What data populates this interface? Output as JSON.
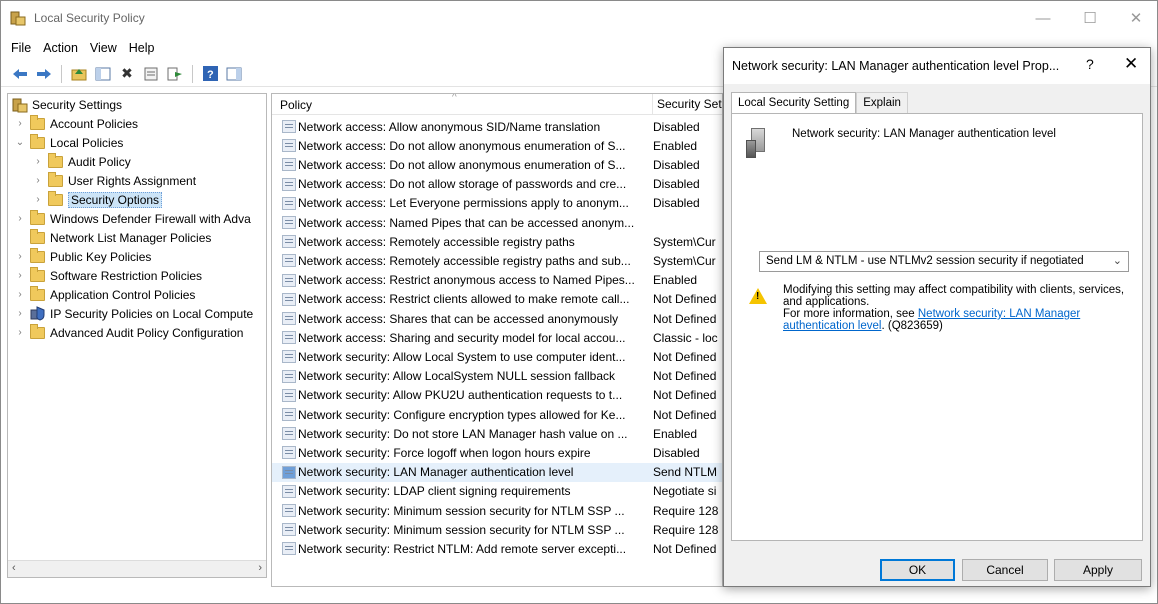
{
  "window": {
    "title": "Local Security Policy",
    "controls": {
      "minimize": "—",
      "maximize": "☐",
      "close": "✕"
    }
  },
  "menu": [
    "File",
    "Action",
    "View",
    "Help"
  ],
  "toolbar_icons": [
    "back-icon",
    "forward-icon",
    "up-folder-icon",
    "show-hide-tree-icon",
    "delete-icon",
    "properties-icon",
    "export-list-icon",
    "help-icon",
    "show-console-icon"
  ],
  "tree": {
    "root": "Security Settings",
    "items": [
      {
        "label": "Account Policies"
      },
      {
        "label": "Local Policies"
      },
      {
        "label": "Audit Policy"
      },
      {
        "label": "User Rights Assignment"
      },
      {
        "label": "Security Options"
      },
      {
        "label": "Windows Defender Firewall with Adva"
      },
      {
        "label": "Network List Manager Policies"
      },
      {
        "label": "Public Key Policies"
      },
      {
        "label": "Software Restriction Policies"
      },
      {
        "label": "Application Control Policies"
      },
      {
        "label": "IP Security Policies on Local Compute"
      },
      {
        "label": "Advanced Audit Policy Configuration"
      }
    ]
  },
  "list": {
    "columns": {
      "policy": "Policy",
      "setting": "Security Set"
    },
    "rows": [
      {
        "policy": "Network access: Allow anonymous SID/Name translation",
        "setting": "Disabled"
      },
      {
        "policy": "Network access: Do not allow anonymous enumeration of S...",
        "setting": "Enabled"
      },
      {
        "policy": "Network access: Do not allow anonymous enumeration of S...",
        "setting": "Disabled"
      },
      {
        "policy": "Network access: Do not allow storage of passwords and cre...",
        "setting": "Disabled"
      },
      {
        "policy": "Network access: Let Everyone permissions apply to anonym...",
        "setting": "Disabled"
      },
      {
        "policy": "Network access: Named Pipes that can be accessed anonym...",
        "setting": ""
      },
      {
        "policy": "Network access: Remotely accessible registry paths",
        "setting": "System\\Cur"
      },
      {
        "policy": "Network access: Remotely accessible registry paths and sub...",
        "setting": "System\\Cur"
      },
      {
        "policy": "Network access: Restrict anonymous access to Named Pipes...",
        "setting": "Enabled"
      },
      {
        "policy": "Network access: Restrict clients allowed to make remote call...",
        "setting": "Not Defined"
      },
      {
        "policy": "Network access: Shares that can be accessed anonymously",
        "setting": "Not Defined"
      },
      {
        "policy": "Network access: Sharing and security model for local accou...",
        "setting": "Classic - loc"
      },
      {
        "policy": "Network security: Allow Local System to use computer ident...",
        "setting": "Not Defined"
      },
      {
        "policy": "Network security: Allow LocalSystem NULL session fallback",
        "setting": "Not Defined"
      },
      {
        "policy": "Network security: Allow PKU2U authentication requests to t...",
        "setting": "Not Defined"
      },
      {
        "policy": "Network security: Configure encryption types allowed for Ke...",
        "setting": "Not Defined"
      },
      {
        "policy": "Network security: Do not store LAN Manager hash value on ...",
        "setting": "Enabled"
      },
      {
        "policy": "Network security: Force logoff when logon hours expire",
        "setting": "Disabled"
      },
      {
        "policy": "Network security: LAN Manager authentication level",
        "setting": "Send NTLM"
      },
      {
        "policy": "Network security: LDAP client signing requirements",
        "setting": "Negotiate si"
      },
      {
        "policy": "Network security: Minimum session security for NTLM SSP ...",
        "setting": "Require 128"
      },
      {
        "policy": "Network security: Minimum session security for NTLM SSP ...",
        "setting": "Require 128"
      },
      {
        "policy": "Network security: Restrict NTLM: Add remote server excepti...",
        "setting": "Not Defined"
      }
    ],
    "selected_index": 18
  },
  "dialog": {
    "title": "Network security: LAN Manager authentication level Prop...",
    "help": "?",
    "close": "✕",
    "tabs": [
      "Local Security Setting",
      "Explain"
    ],
    "setting_name": "Network security: LAN Manager authentication level",
    "selected_option": "Send LM & NTLM - use NTLMv2 session security if negotiated",
    "warning_line1": "Modifying this setting may affect compatibility with clients, services, and applications.",
    "warning_more_prefix": "For more information, see",
    "warning_link": "Network security: LAN Manager authentication level",
    "warning_kb": ". (Q823659)",
    "buttons": {
      "ok": "OK",
      "cancel": "Cancel",
      "apply": "Apply"
    }
  }
}
